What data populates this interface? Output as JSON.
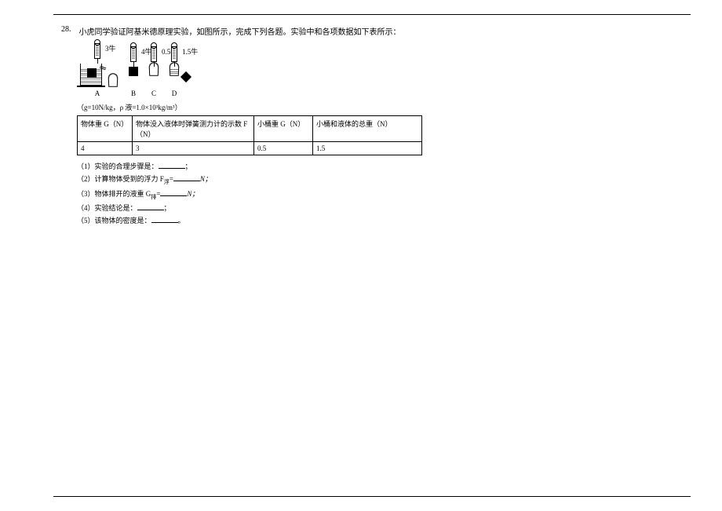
{
  "question": {
    "number": "28.",
    "stem": "小虎同学验证阿基米德原理实验，如图所示，完成下列各题。实验中和各项数据如下表所示："
  },
  "diagram": {
    "readings": {
      "a": "3牛",
      "b": "4牛",
      "c": "0.5牛",
      "d": "1.5牛"
    },
    "labels": {
      "a": "A",
      "b": "B",
      "c": "C",
      "d": "D"
    }
  },
  "constants": "（g=10N/kg，ρ 液=1.0×10³kg/m³）",
  "table": {
    "headers": {
      "c1": "物体重 G（N）",
      "c2": "物体没入液体时弹簧测力计的示数 F（N）",
      "c3": "小桶重 G（N）",
      "c4": "小桶和液体的总重（N）"
    },
    "row": {
      "c1": "4",
      "c2": "3",
      "c3": "0.5",
      "c4": "1.5"
    }
  },
  "subq": {
    "q1_pre": "（1）实验的合理步骤是：",
    "q1_post": "；",
    "q2_pre": "（2）计算物体受到的浮力 F",
    "q2_sub": "浮",
    "q2_mid": "=",
    "q2_post": "N；",
    "q3_pre": "（3）物体排开的液重 G",
    "q3_sub": "排",
    "q3_mid": "=",
    "q3_post": "N；",
    "q4_pre": "（4）实验结论是：",
    "q4_post": "；",
    "q5_pre": "（5）该物体的密度是：",
    "q5_post": "。"
  }
}
